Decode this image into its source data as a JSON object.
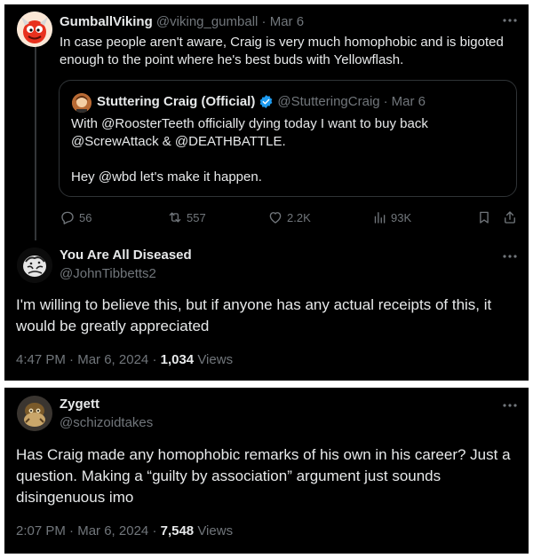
{
  "reply1": {
    "author": "GumballViking",
    "handle": "@viking_gumball",
    "separator": "·",
    "date": "Mar 6",
    "text_line1": "In case people aren't aware, Craig is very much homophobic and is bigoted",
    "text_line2": "enough to the point where he's best buds with Yellowflash.",
    "quote": {
      "author": "Stuttering Craig (Official)",
      "handle": "@StutteringCraig",
      "separator": "·",
      "date": "Mar 6",
      "line1": "With @RoosterTeeth officially dying today I want to buy back",
      "line2": "@ScrewAttack & @DEATHBATTLE.",
      "line3": "Hey @wbd let's make it happen."
    },
    "stats": {
      "replies": "56",
      "reposts": "557",
      "likes": "2.2K",
      "views": "93K"
    }
  },
  "post1": {
    "author": "You Are All Diseased",
    "handle": "@JohnTibbetts2",
    "text_line1": "I'm willing to believe this, but if anyone has any actual receipts of this, it",
    "text_line2": "would be greatly appreciated",
    "time": "4:47 PM",
    "separator": "·",
    "date": "Mar 6, 2024",
    "views_count": "1,034",
    "views_label": "Views"
  },
  "post2": {
    "author": "Zygett",
    "handle": "@schizoidtakes",
    "text_line1": "Has Craig made any homophobic remarks of his own in his career? Just a",
    "text_line2": "question. Making a “guilty by association” argument just sounds",
    "text_line3": "disingenuous imo",
    "time": "2:07 PM",
    "separator": "·",
    "date": "Mar 6, 2024",
    "views_count": "7,548",
    "views_label": "Views"
  },
  "colors": {
    "background": "#000000",
    "text": "#e7e9ea",
    "muted": "#71767b",
    "verified": "#1d9bf0"
  },
  "icons": [
    "more-icon",
    "verified-icon",
    "reply-icon",
    "repost-icon",
    "like-icon",
    "views-icon",
    "bookmark-icon",
    "share-icon"
  ]
}
